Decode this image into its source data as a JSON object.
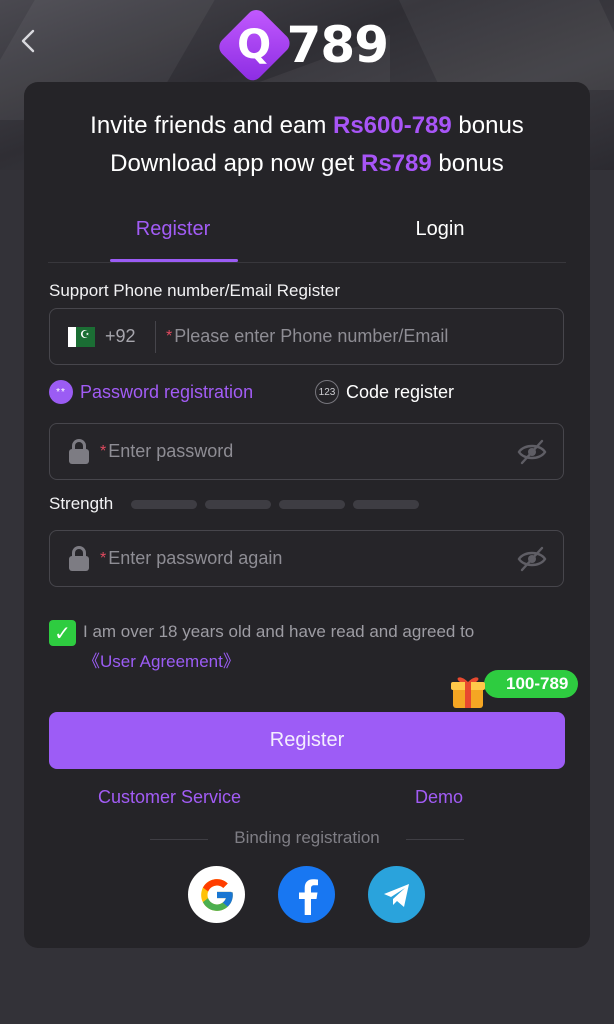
{
  "header": {
    "back_label": "‹",
    "logo_letter": "Q",
    "logo_number": "789"
  },
  "promo": {
    "line1_prefix": "Invite friends and eam ",
    "line1_amount": "Rs600-789",
    "line1_suffix": " bonus",
    "line2_prefix": "Download app now get ",
    "line2_amount": "Rs789",
    "line2_suffix": " bonus"
  },
  "tabs": [
    {
      "label": "Register",
      "active": true
    },
    {
      "label": "Login",
      "active": false
    }
  ],
  "phone": {
    "label": "Support Phone number/Email Register",
    "country_code": "+92",
    "required_mark": "*",
    "placeholder": "Please enter Phone number/Email"
  },
  "reg_methods": {
    "password_icon": "**",
    "password_label": "Password registration",
    "code_icon": "123",
    "code_label": "Code register"
  },
  "password": {
    "required_mark": "*",
    "placeholder": "Enter password"
  },
  "strength": {
    "label": "Strength"
  },
  "confirm": {
    "required_mark": "*",
    "placeholder": "Enter password again"
  },
  "agreement": {
    "checked": true,
    "check_mark": "✓",
    "text": "I am over 18 years old and have read and agreed to",
    "link": "《User Agreement》"
  },
  "bonus_badge": "100-789",
  "register_button": "Register",
  "links": {
    "customer_service": "Customer Service",
    "demo": "Demo"
  },
  "binding": {
    "label": "Binding registration"
  },
  "colors": {
    "accent": "#9d5cf6",
    "success": "#2ecc40",
    "card": "#252428",
    "background": "#333238"
  }
}
